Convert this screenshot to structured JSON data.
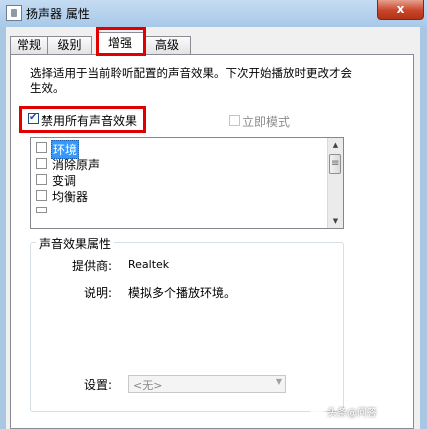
{
  "window": {
    "title": "扬声器 属性",
    "close_label": "x",
    "accent": "#e00000"
  },
  "tabs": [
    "常规",
    "级别",
    "增强",
    "高级"
  ],
  "active_tab": "增强",
  "description": "选择适用于当前聆听配置的声音效果。下次开始播放时更改才会生效。",
  "disable_all": {
    "label": "禁用所有声音效果",
    "checked": true
  },
  "immediate_mode": {
    "label": "立即模式",
    "checked": false,
    "enabled": false
  },
  "effects": [
    {
      "label": "环境",
      "checked": false,
      "selected": true
    },
    {
      "label": "消除原声",
      "checked": false,
      "selected": false
    },
    {
      "label": "变调",
      "checked": false,
      "selected": false
    },
    {
      "label": "均衡器",
      "checked": false,
      "selected": false
    }
  ],
  "properties": {
    "group_title": "声音效果属性",
    "provider_label": "提供商:",
    "provider_value": "Realtek",
    "desc_label": "说明:",
    "desc_value": "模拟多个播放环境。",
    "settings_label": "设置:",
    "settings_value": "<无>"
  },
  "watermark": "头条@问答"
}
